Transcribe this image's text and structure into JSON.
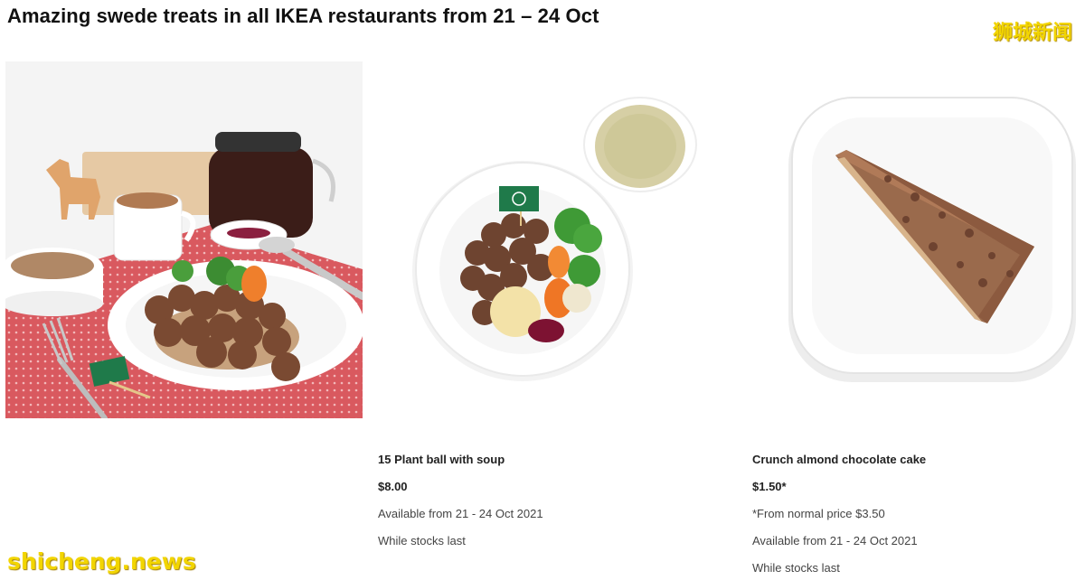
{
  "page": {
    "title": "Amazing swede treats in all IKEA restaurants from 21 – 24 Oct"
  },
  "watermarks": {
    "top": "狮城新闻",
    "bottom": "shicheng.news"
  },
  "products": [
    {
      "name": "15 Plant ball with soup",
      "price": "$8.00",
      "lines": [
        "Available from 21 - 24 Oct 2021",
        "While stocks last"
      ]
    },
    {
      "name": "Crunch almond chocolate cake",
      "price": "$1.50*",
      "lines": [
        "*From normal price $3.50",
        "Available from 21 - 24 Oct 2021",
        "While stocks last"
      ]
    }
  ],
  "colors": {
    "watermark": "#f2d500",
    "tablecloth": "#d9595f",
    "plant_flag": "#1f7a4a"
  }
}
